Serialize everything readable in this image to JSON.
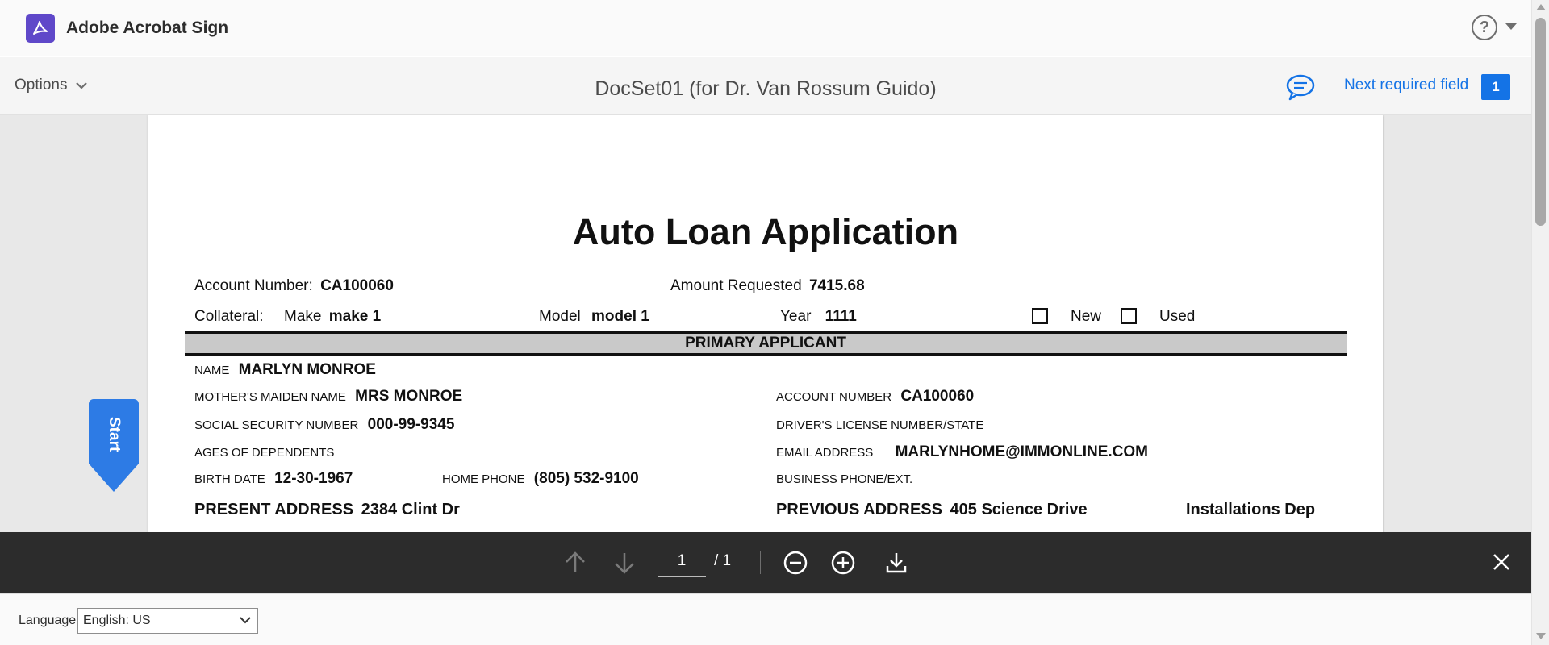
{
  "app": {
    "title": "Adobe Acrobat Sign",
    "help_icon": "?"
  },
  "toolbar": {
    "options_label": "Options",
    "doc_title": "DocSet01 (for Dr. Van Rossum Guido)",
    "next_field_label": "Next required field",
    "next_field_count": "1"
  },
  "document": {
    "heading": "Auto Loan Application",
    "account_number_label": "Account Number:",
    "account_number_value": "CA100060",
    "amount_requested_label": "Amount Requested",
    "amount_requested_value": "7415.68",
    "collateral_label": "Collateral:",
    "make_label": "Make",
    "make_value": "make 1",
    "model_label": "Model",
    "model_value": "model 1",
    "year_label": "Year",
    "year_value": "1111",
    "new_label": "New",
    "used_label": "Used",
    "section_primary": "PRIMARY APPLICANT",
    "name_label": "NAME",
    "name_value": "MARLYN MONROE",
    "maiden_label": "MOTHER'S MAIDEN NAME",
    "maiden_value": "MRS MONROE",
    "acct_label": "ACCOUNT NUMBER",
    "acct_value": "CA100060",
    "ssn_label": "SOCIAL SECURITY NUMBER",
    "ssn_value": "000-99-9345",
    "dl_label": "DRIVER'S LICENSE NUMBER/STATE",
    "ages_label": "AGES OF DEPENDENTS",
    "email_label": "EMAIL ADDRESS",
    "email_value": "MARLYNHOME@IMMONLINE.COM",
    "birth_label": "BIRTH DATE",
    "birth_value": "12-30-1967",
    "home_phone_label": "HOME PHONE",
    "home_phone_value": "(805) 532-9100",
    "business_phone_label": "BUSINESS PHONE/EXT.",
    "present_addr_label": "PRESENT ADDRESS",
    "present_addr_value": "2384 Clint Dr",
    "previous_addr_label": "PREVIOUS ADDRESS",
    "previous_addr_value": "405 Science Drive",
    "previous_addr_extra": "Installations Dep"
  },
  "start_tab": {
    "label": "Start"
  },
  "controls": {
    "current_page": "1",
    "total_pages": "/ 1"
  },
  "footer": {
    "language_label": "Language",
    "language_value": "English: US"
  },
  "colors": {
    "accent": "#1473e6",
    "start_tab": "#2d7be5",
    "control_bar": "#2c2c2c",
    "logo": "#5f48c9"
  }
}
